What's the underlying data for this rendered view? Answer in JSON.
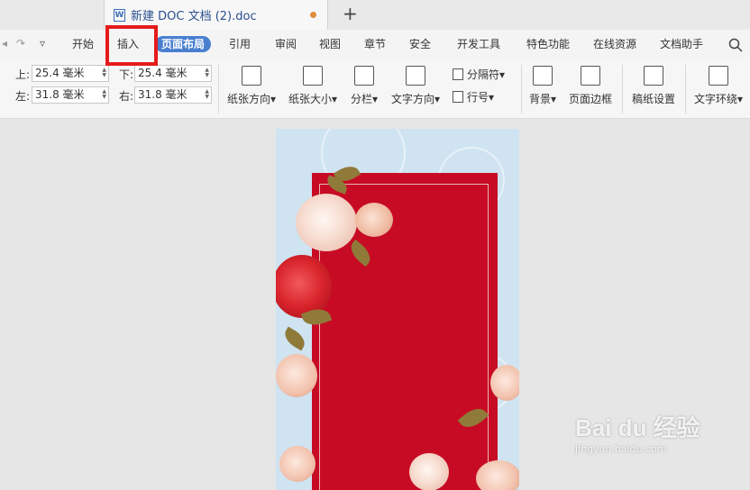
{
  "tab": {
    "title": "新建 DOC 文档 (2).doc",
    "icon": "W",
    "new_tab": "+"
  },
  "menu": {
    "items": [
      "开始",
      "插入",
      "页面布局",
      "引用",
      "审阅",
      "视图",
      "章节",
      "安全",
      "开发工具",
      "特色功能",
      "在线资源",
      "文档助手"
    ],
    "active": "页面布局"
  },
  "margins": {
    "top_label": "上:",
    "top_value": "25.4 毫米",
    "bottom_label": "下:",
    "bottom_value": "25.4 毫米",
    "left_label": "左:",
    "left_value": "31.8 毫米",
    "right_label": "右:",
    "right_value": "31.8 毫米"
  },
  "ribbon": {
    "orientation": "纸张方向",
    "size": "纸张大小",
    "columns": "分栏",
    "text_direction": "文字方向",
    "breaks": "分隔符",
    "line_numbers": "行号",
    "background": "背景",
    "page_border": "页面边框",
    "paper_settings": "稿纸设置",
    "text_wrap": "文字环绕"
  },
  "watermark": {
    "main": "Bai du 经验",
    "sub": "jingyan.baidu.com"
  },
  "colors": {
    "accent": "#4a7fd0",
    "highlight": "#e51b1b",
    "card": "#c70b24",
    "page_bg": "#cfe3f1"
  }
}
